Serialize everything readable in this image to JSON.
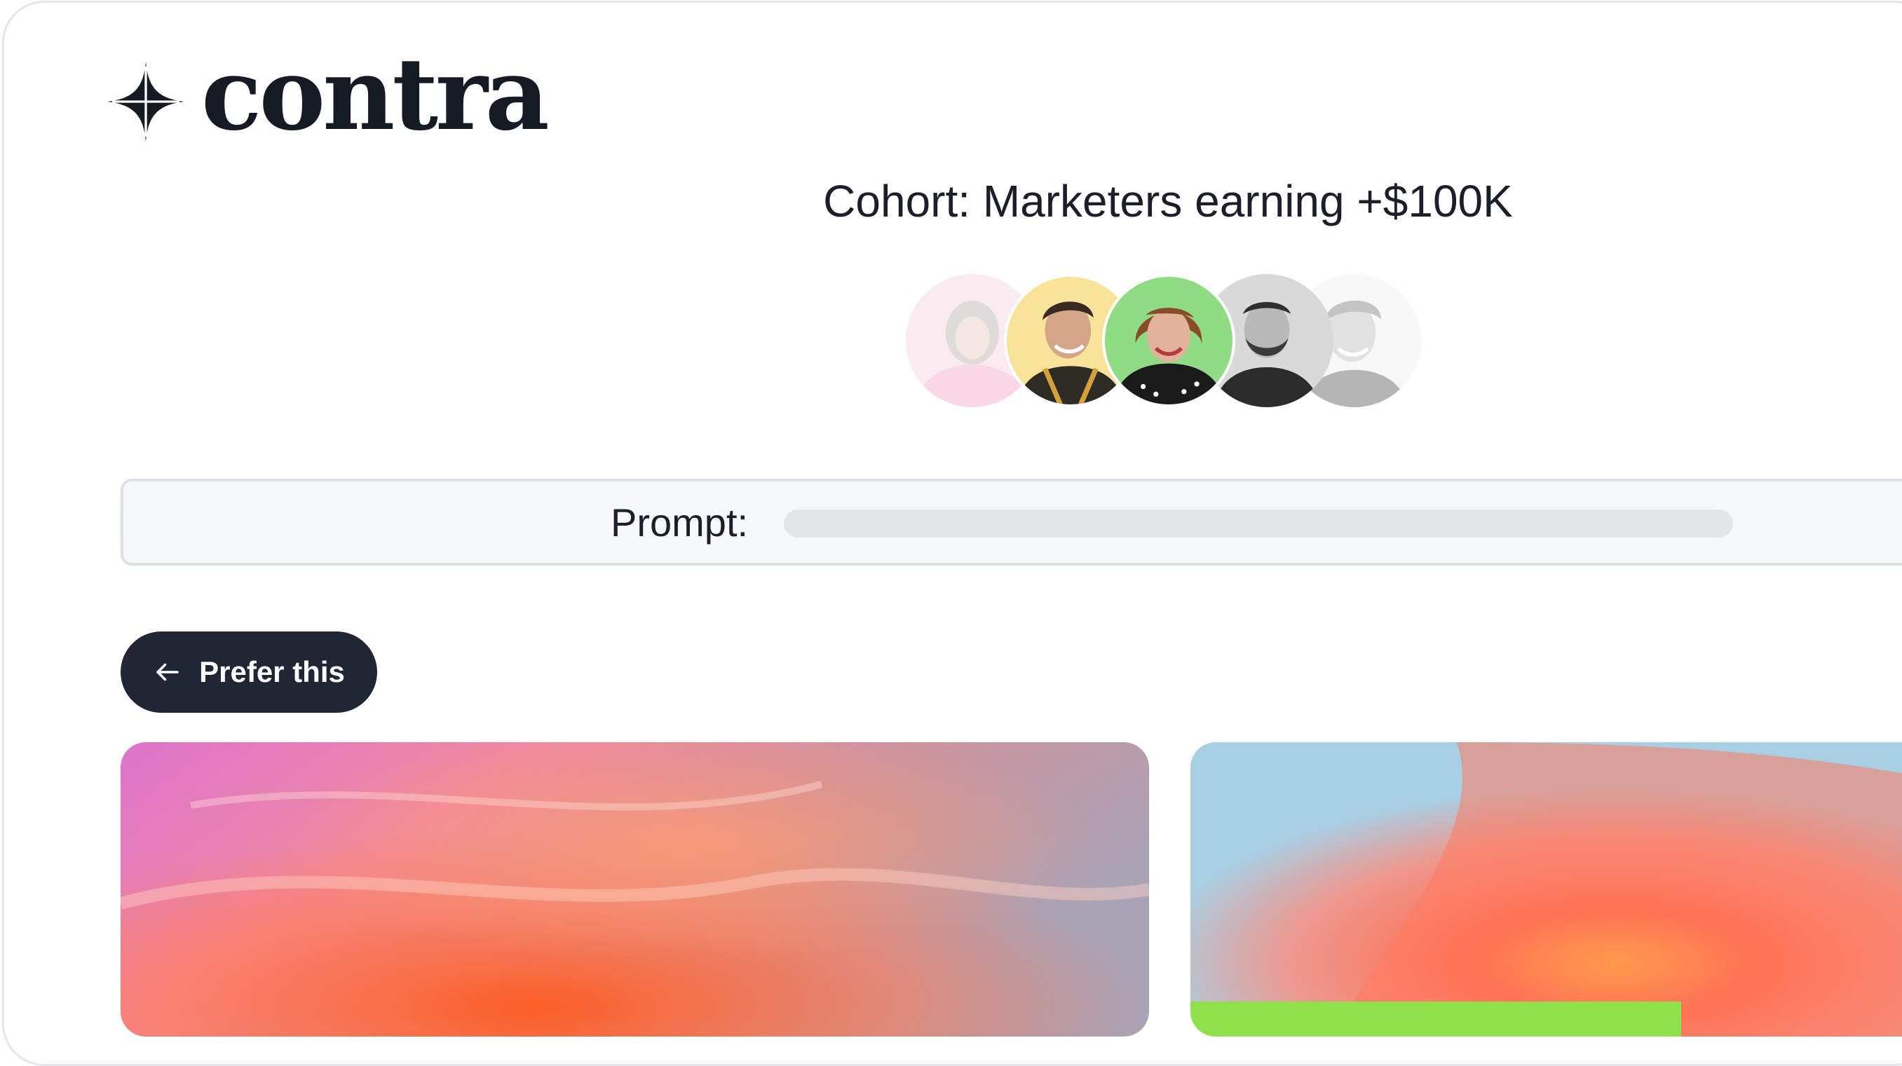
{
  "brand": {
    "name": "contra"
  },
  "cohort": {
    "title": "Cohort: Marketers earning +$100K"
  },
  "avatars": [
    {
      "name": "avatar-1",
      "bg": "#f6d3df"
    },
    {
      "name": "avatar-2",
      "bg": "#f7e49a"
    },
    {
      "name": "avatar-3",
      "bg": "#8fdc84"
    },
    {
      "name": "avatar-4",
      "bg": "#d9d9d9"
    },
    {
      "name": "avatar-5",
      "bg": "#ececec"
    }
  ],
  "prompt": {
    "label": "Prompt:"
  },
  "actions": {
    "prefer_label": "Prefer this",
    "prefer_icon": "arrow-left-icon"
  },
  "colors": {
    "button_bg": "#202633",
    "text": "#1b1f2a",
    "border": "#dde0e5"
  }
}
